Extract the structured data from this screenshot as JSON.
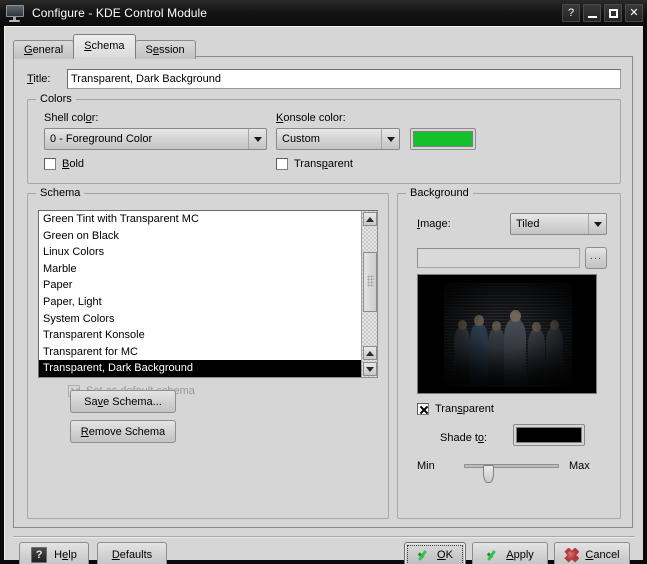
{
  "window": {
    "title": "Configure - KDE Control Module",
    "icon": "display-monitor-icon",
    "buttons": {
      "help": "?",
      "minimize": "_",
      "maximize": "□",
      "close": "✕"
    }
  },
  "tabs": [
    {
      "label": "General",
      "acc": "G",
      "active": false
    },
    {
      "label": "Schema",
      "acc": "S",
      "active": true
    },
    {
      "label": "Session",
      "acc": "S",
      "active": false
    }
  ],
  "title_field": {
    "label": "Title:",
    "acc": "T",
    "value": "Transparent, Dark Background",
    "placeholder": ""
  },
  "colors_group": {
    "legend": "Colors",
    "shell_color": {
      "label": "Shell color:",
      "acc": "o",
      "value": "0 - Foreground Color",
      "options": [
        "0 - Foreground Color"
      ]
    },
    "konsole_color": {
      "label": "Konsole color:",
      "acc": "K",
      "value": "Custom",
      "options": [
        "Custom"
      ],
      "swatch_color": "#14c12b"
    },
    "bold": {
      "label": "Bold",
      "acc": "B",
      "checked": false
    },
    "transparent": {
      "label": "Transparent",
      "acc": "p",
      "checked": false
    }
  },
  "schema_group": {
    "legend": "Schema",
    "items": [
      "Green Tint with Transparent MC",
      "Green on Black",
      "Linux Colors",
      "Marble",
      "Paper",
      "Paper, Light",
      "System Colors",
      "Transparent Konsole",
      "Transparent for MC",
      "Transparent, Dark Background"
    ],
    "selected_index": 9,
    "set_default": {
      "label": "Set as default schema",
      "acc": "t",
      "checked": true,
      "enabled": false
    },
    "save_button": "Save Schema...",
    "save_acc": "v",
    "remove_button": "Remove Schema",
    "remove_acc": "R"
  },
  "background_group": {
    "legend": "Background",
    "image": {
      "label": "Image:",
      "acc": "I",
      "value": "Tiled",
      "options": [
        "Tiled"
      ]
    },
    "path_value": "",
    "browse_label": "...",
    "transparent": {
      "label": "Transparent",
      "acc": "s",
      "checked": true
    },
    "shade_to": {
      "label": "Shade to:",
      "acc": "o",
      "color": "#000000"
    },
    "slider": {
      "min_label": "Min",
      "max_label": "Max",
      "value_percent": 22
    }
  },
  "bottom_bar": {
    "help": "Help",
    "help_acc": "e",
    "defaults": "Defaults",
    "defaults_acc": "D",
    "ok": "OK",
    "ok_acc": "O",
    "apply": "Apply",
    "apply_acc": "A",
    "cancel": "Cancel",
    "cancel_acc": "C"
  }
}
